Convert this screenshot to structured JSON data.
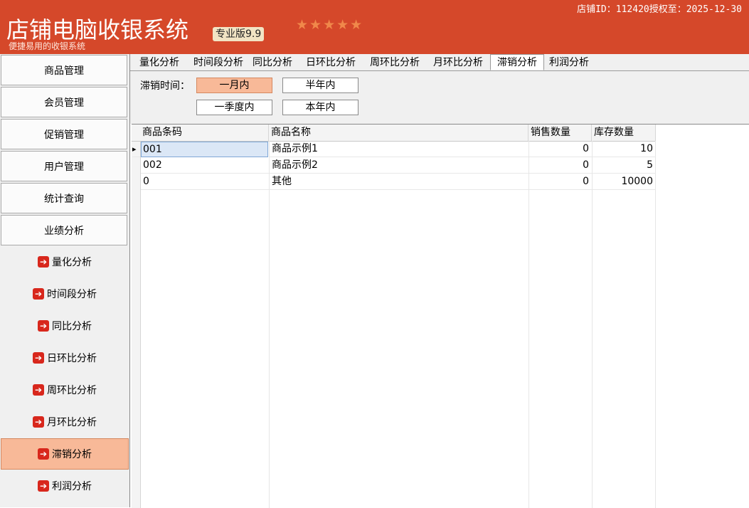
{
  "header": {
    "app_title": "店铺电脑收银系统",
    "edition": "专业版9.9",
    "subtitle": "便捷易用的收银系统",
    "stars": "★★★★★",
    "license": "店铺ID：112420授权至：2025-12-30"
  },
  "sidebar": {
    "main_items": [
      "商品管理",
      "会员管理",
      "促销管理",
      "用户管理",
      "统计查询",
      "业绩分析"
    ],
    "sub_items": [
      "量化分析",
      "时间段分析",
      "同比分析",
      "日环比分析",
      "周环比分析",
      "月环比分析",
      "滞销分析",
      "利润分析"
    ],
    "active_sub": "滞销分析",
    "arrow_glyph": "➔"
  },
  "tabs": [
    "量化分析",
    "时间段分析",
    "同比分析",
    "日环比分析",
    "周环比分析",
    "月环比分析",
    "滞销分析",
    "利润分析"
  ],
  "active_tab": "滞销分析",
  "filter": {
    "label": "滞销时间：",
    "buttons": [
      "一月内",
      "半年内",
      "一季度内",
      "本年内"
    ],
    "active": "一月内"
  },
  "table": {
    "columns": [
      "商品条码",
      "商品名称",
      "销售数量",
      "库存数量"
    ],
    "rows": [
      {
        "code": "001",
        "name": "商品示例1",
        "sold": "0",
        "stock": "10"
      },
      {
        "code": "002",
        "name": "商品示例2",
        "sold": "0",
        "stock": "5"
      },
      {
        "code": "0",
        "name": "其他",
        "sold": "0",
        "stock": "10000"
      }
    ],
    "current_row_marker": "▸"
  },
  "colors": {
    "header_bg": "#d5482a",
    "active_bg": "#f8b998",
    "arrow_icon": "#d8271c"
  }
}
